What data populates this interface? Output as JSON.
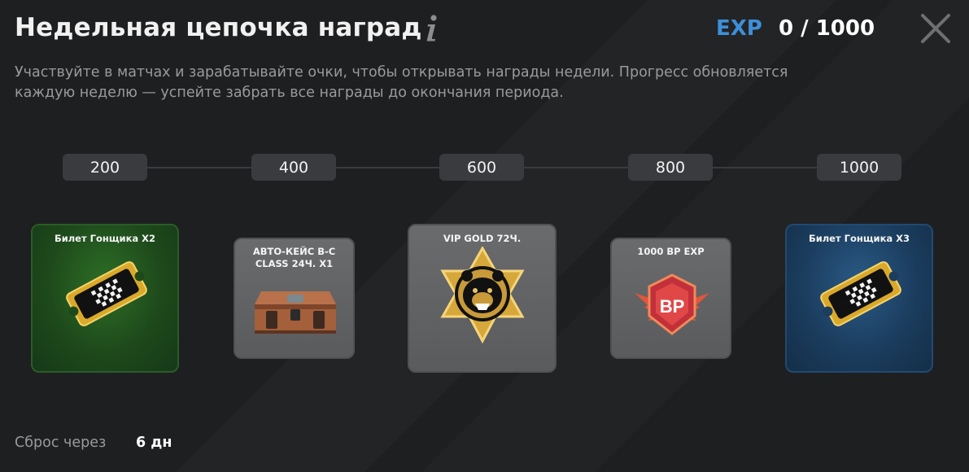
{
  "header": {
    "title": "Недельная цепочка наград",
    "exp_label": "EXP",
    "exp_value": "0 / 1000"
  },
  "description": {
    "line1": "Участвуйте в матчах и зарабатывайте очки, чтобы открывать награды недели. Прогресс обновляется",
    "line2": "каждую неделю — успейте забрать все награды до окончания периода."
  },
  "progress": {
    "current": 0,
    "max": 1000
  },
  "milestones": [
    "200",
    "400",
    "600",
    "800",
    "1000"
  ],
  "rewards": [
    {
      "label": "Билет Гонщика X2",
      "style": "green",
      "icon": "racer-ticket-icon"
    },
    {
      "label_line1": "АВТО-КЕЙС B-C",
      "label_line2": "CLASS 24Ч. X1",
      "style": "gray",
      "icon": "car-case-icon"
    },
    {
      "label": "VIP GOLD 72Ч.",
      "style": "gray",
      "icon": "vip-gold-bear-icon"
    },
    {
      "label": "1000 BP EXP",
      "style": "gray",
      "icon": "bp-exp-icon",
      "icon_text": "BP"
    },
    {
      "label": "Билет Гонщика X3",
      "style": "blue",
      "icon": "racer-ticket-icon"
    }
  ],
  "footer": {
    "reset_label": "Сброс через",
    "reset_value": "6 дн"
  },
  "colors": {
    "background": "#1e1f21",
    "accent_blue": "#3d8fd8",
    "milestone_bg": "#3a3b3e",
    "card_green": "#1e4a1b",
    "card_blue": "#1b3d5e",
    "card_gray": "#5a5b5d"
  }
}
